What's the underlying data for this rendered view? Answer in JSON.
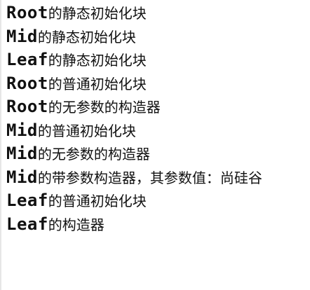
{
  "console": {
    "lines": [
      {
        "name": "Root",
        "message": "的静态初始化块"
      },
      {
        "name": "Mid",
        "message": "的静态初始化块"
      },
      {
        "name": "Leaf",
        "message": "的静态初始化块"
      },
      {
        "name": "Root",
        "message": "的普通初始化块"
      },
      {
        "name": "Root",
        "message": "的无参数的构造器"
      },
      {
        "name": "Mid",
        "message": "的普通初始化块"
      },
      {
        "name": "Mid",
        "message": "的无参数的构造器"
      },
      {
        "name": "Mid",
        "message": "的带参数构造器，其参数值：尚硅谷"
      },
      {
        "name": "Leaf",
        "message": "的普通初始化块"
      },
      {
        "name": "Leaf",
        "message": "的构造器"
      }
    ]
  }
}
